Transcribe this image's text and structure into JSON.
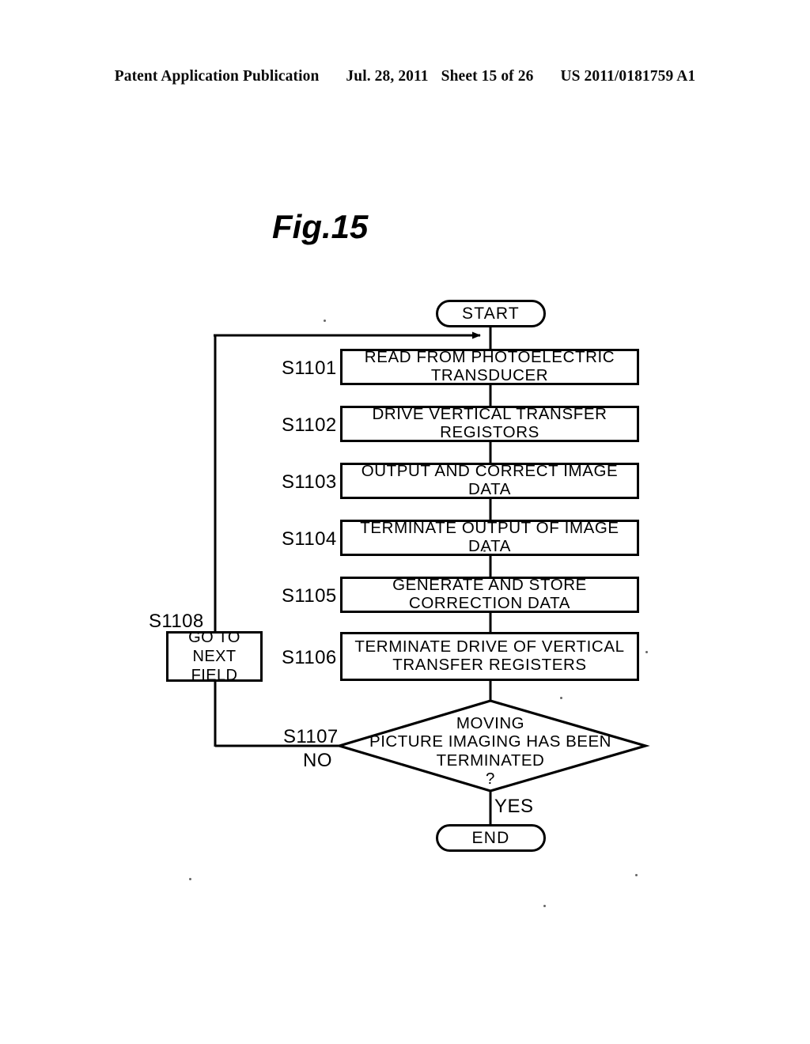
{
  "page_header": {
    "publication": "Patent Application Publication",
    "date": "Jul. 28, 2011",
    "sheet": "Sheet 15 of 26",
    "patent_number": "US 2011/0181759 A1"
  },
  "figure": {
    "title": "Fig.15"
  },
  "flowchart": {
    "type": "flowchart",
    "start": {
      "label": "START"
    },
    "end": {
      "label": "END"
    },
    "steps": [
      {
        "id": "S1101",
        "text": "READ FROM PHOTOELECTRIC TRANSDUCER"
      },
      {
        "id": "S1102",
        "text": "DRIVE VERTICAL TRANSFER REGISTORS"
      },
      {
        "id": "S1103",
        "text": "OUTPUT AND CORRECT IMAGE DATA"
      },
      {
        "id": "S1104",
        "text": "TERMINATE OUTPUT OF IMAGE DATA"
      },
      {
        "id": "S1105",
        "text": "GENERATE AND STORE CORRECTION DATA"
      },
      {
        "id": "S1106",
        "text": "TERMINATE DRIVE OF VERTICAL\nTRANSFER REGISTERS"
      }
    ],
    "decision": {
      "id": "S1107",
      "text": "MOVING\nPICTURE IMAGING HAS BEEN\nTERMINATED\n?",
      "no_label": "NO",
      "yes_label": "YES"
    },
    "loop_box": {
      "id": "S1108",
      "text": "GO TO\nNEXT FIELD"
    },
    "colors": {
      "ink": "#000000",
      "paper": "#ffffff"
    }
  }
}
